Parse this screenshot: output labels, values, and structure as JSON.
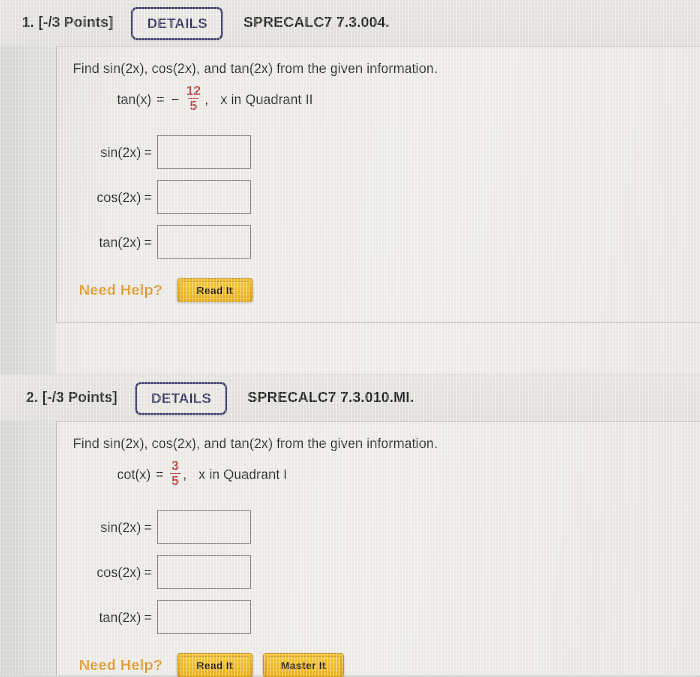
{
  "page": {
    "background_color": "#efedea",
    "gutter_color": "#dcdbd8"
  },
  "problems": [
    {
      "number": "1.",
      "points": "[-/3 Points]",
      "details_label": "DETAILS",
      "code": "SPRECALC7 7.3.004.",
      "question": "Find sin(2x), cos(2x), and tan(2x) from the given information.",
      "given": {
        "function": "tan(x)",
        "equals": "=",
        "sign": "−",
        "numerator": "12",
        "denominator": "5",
        "comma": ",",
        "quadrant": "x in Quadrant II"
      },
      "answers": [
        {
          "label": "sin(2x)",
          "eq": "=",
          "value": ""
        },
        {
          "label": "cos(2x)",
          "eq": "=",
          "value": ""
        },
        {
          "label": "tan(2x)",
          "eq": "=",
          "value": ""
        }
      ],
      "help_label": "Need Help?",
      "help_buttons": [
        "Read It"
      ]
    },
    {
      "number": "2.",
      "points": "[-/3 Points]",
      "details_label": "DETAILS",
      "code": "SPRECALC7 7.3.010.MI.",
      "question": "Find sin(2x), cos(2x), and tan(2x) from the given information.",
      "given": {
        "function": "cot(x)",
        "equals": "=",
        "sign": "",
        "numerator": "3",
        "denominator": "5",
        "comma": ",",
        "quadrant": "x in Quadrant I"
      },
      "answers": [
        {
          "label": "sin(2x)",
          "eq": "=",
          "value": ""
        },
        {
          "label": "cos(2x)",
          "eq": "=",
          "value": ""
        },
        {
          "label": "tan(2x)",
          "eq": "=",
          "value": ""
        }
      ],
      "help_label": "Need Help?",
      "help_buttons": [
        "Read It",
        "Master It"
      ]
    }
  ],
  "colors": {
    "details_border": "#3c3d6b",
    "details_text": "#35365f",
    "fraction_red": "#b4403e",
    "need_help_orange": "#e09a2c",
    "button_gold": "#eead15",
    "input_border": "#8d8b86"
  }
}
